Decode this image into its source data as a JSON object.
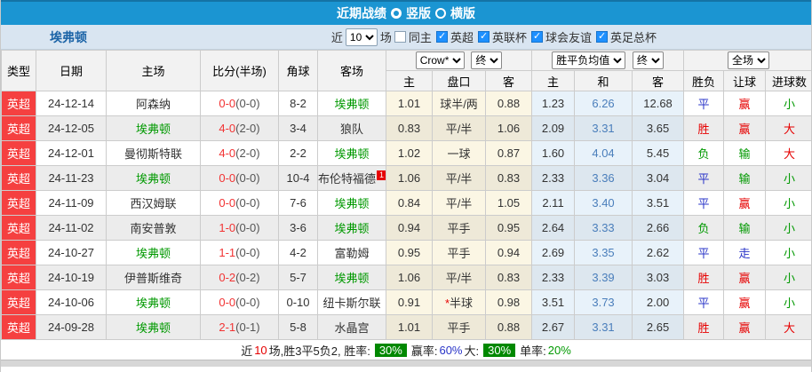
{
  "titlebar": {
    "title": "近期战绩",
    "radio_vertical_label": "竖版",
    "radio_horizontal_label": "横版"
  },
  "subheader": {
    "team": "埃弗顿",
    "near_label": "近",
    "match_count": "10",
    "games_label": "场",
    "same_home_label": "同主",
    "league_filters": [
      "英超",
      "英联杯",
      "球会友谊",
      "英足总杯"
    ]
  },
  "table": {
    "selects": {
      "bookmaker": "Crow*",
      "bookmaker_state": "终",
      "avg": "胜平负均值",
      "avg_state": "终",
      "scope": "全场"
    },
    "columns": {
      "type": "类型",
      "date": "日期",
      "home": "主场",
      "score": "比分(半场)",
      "corners": "角球",
      "away": "客场",
      "odds_home": "主",
      "handicap": "盘口",
      "odds_away": "客",
      "avg_home": "主",
      "avg_draw": "和",
      "avg_away": "客",
      "result": "胜负",
      "let_result": "让球",
      "goal_result": "进球数"
    },
    "rows": [
      {
        "type": "英超",
        "date": "24-12-14",
        "home": "阿森纳",
        "score_ft": "0-0",
        "score_ht": "(0-0)",
        "corners": "8-2",
        "away": "埃弗顿",
        "odds_home": "1.01",
        "handicap": "球半/两",
        "odds_away": "0.88",
        "avg_home": "1.23",
        "avg_draw": "6.26",
        "avg_away": "12.68",
        "result": "平",
        "let_result": "赢",
        "goal_result": "小"
      },
      {
        "type": "英超",
        "date": "24-12-05",
        "home": "埃弗顿",
        "score_ft": "4-0",
        "score_ht": "(2-0)",
        "corners": "3-4",
        "away": "狼队",
        "odds_home": "0.83",
        "handicap": "平/半",
        "odds_away": "1.06",
        "avg_home": "2.09",
        "avg_draw": "3.31",
        "avg_away": "3.65",
        "result": "胜",
        "let_result": "赢",
        "goal_result": "大"
      },
      {
        "type": "英超",
        "date": "24-12-01",
        "home": "曼彻斯特联",
        "score_ft": "4-0",
        "score_ht": "(2-0)",
        "corners": "2-2",
        "away": "埃弗顿",
        "odds_home": "1.02",
        "handicap": "一球",
        "odds_away": "0.87",
        "avg_home": "1.60",
        "avg_draw": "4.04",
        "avg_away": "5.45",
        "result": "负",
        "let_result": "输",
        "goal_result": "大"
      },
      {
        "type": "英超",
        "date": "24-11-23",
        "home": "埃弗顿",
        "score_ft": "0-0",
        "score_ht": "(0-0)",
        "corners": "10-4",
        "away": "布伦特福德",
        "away_badge": "1",
        "odds_home": "1.06",
        "handicap": "平/半",
        "odds_away": "0.83",
        "avg_home": "2.33",
        "avg_draw": "3.36",
        "avg_away": "3.04",
        "result": "平",
        "let_result": "输",
        "goal_result": "小"
      },
      {
        "type": "英超",
        "date": "24-11-09",
        "home": "西汉姆联",
        "score_ft": "0-0",
        "score_ht": "(0-0)",
        "corners": "7-6",
        "away": "埃弗顿",
        "odds_home": "0.84",
        "handicap": "平/半",
        "odds_away": "1.05",
        "avg_home": "2.11",
        "avg_draw": "3.40",
        "avg_away": "3.51",
        "result": "平",
        "let_result": "赢",
        "goal_result": "小"
      },
      {
        "type": "英超",
        "date": "24-11-02",
        "home": "南安普敦",
        "score_ft": "1-0",
        "score_ht": "(0-0)",
        "corners": "3-6",
        "away": "埃弗顿",
        "odds_home": "0.94",
        "handicap": "平手",
        "odds_away": "0.95",
        "avg_home": "2.64",
        "avg_draw": "3.33",
        "avg_away": "2.66",
        "result": "负",
        "let_result": "输",
        "goal_result": "小"
      },
      {
        "type": "英超",
        "date": "24-10-27",
        "home": "埃弗顿",
        "score_ft": "1-1",
        "score_ht": "(0-0)",
        "corners": "4-2",
        "away": "富勒姆",
        "odds_home": "0.95",
        "handicap": "平手",
        "odds_away": "0.94",
        "avg_home": "2.69",
        "avg_draw": "3.35",
        "avg_away": "2.62",
        "result": "平",
        "let_result": "走",
        "goal_result": "小"
      },
      {
        "type": "英超",
        "date": "24-10-19",
        "home": "伊普斯维奇",
        "score_ft": "0-2",
        "score_ht": "(0-2)",
        "corners": "5-7",
        "away": "埃弗顿",
        "odds_home": "1.06",
        "handicap": "平/半",
        "odds_away": "0.83",
        "avg_home": "2.33",
        "avg_draw": "3.39",
        "avg_away": "3.03",
        "result": "胜",
        "let_result": "赢",
        "goal_result": "小"
      },
      {
        "type": "英超",
        "date": "24-10-06",
        "home": "埃弗顿",
        "score_ft": "0-0",
        "score_ht": "(0-0)",
        "corners": "0-10",
        "away": "纽卡斯尔联",
        "odds_home": "0.91",
        "handicap": "半球",
        "handicap_star": "*",
        "odds_away": "0.98",
        "avg_home": "3.51",
        "avg_draw": "3.73",
        "avg_away": "2.00",
        "result": "平",
        "let_result": "赢",
        "goal_result": "小"
      },
      {
        "type": "英超",
        "date": "24-09-28",
        "home": "埃弗顿",
        "score_ft": "2-1",
        "score_ht": "(0-1)",
        "corners": "5-8",
        "away": "水晶宫",
        "odds_home": "1.01",
        "handicap": "平手",
        "odds_away": "0.88",
        "avg_home": "2.67",
        "avg_draw": "3.31",
        "avg_away": "2.65",
        "result": "胜",
        "let_result": "赢",
        "goal_result": "大"
      }
    ]
  },
  "summary": {
    "near": "近",
    "count": "10",
    "rest": "场,胜3平5负2, 胜率:",
    "win_rate": "30%",
    "let_label": "赢率:",
    "let_rate": "60%",
    "big_label": "大:",
    "big_rate": "30%",
    "single_label": "单率:",
    "single_rate": "20%"
  },
  "colors": {
    "titlebar_blue": "#1b95d2",
    "subheader_blue": "#d9e5f1",
    "league_red": "#f54040",
    "team_green": "#009900",
    "win_red": "#e60000",
    "draw_blue": "#2a35c8",
    "lose_green": "#009900",
    "rate_badge_green": "#008800"
  }
}
